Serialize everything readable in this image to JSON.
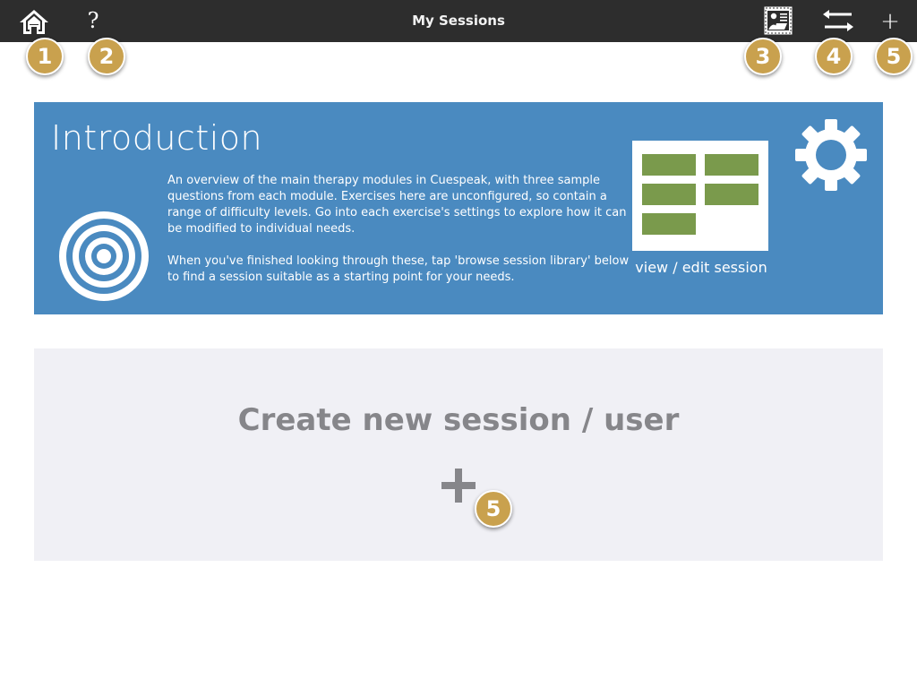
{
  "topbar": {
    "title": "My Sessions",
    "help_label": "?",
    "add_label": "+",
    "icons": {
      "home": "home-icon",
      "help": "question-icon",
      "media": "image-list-icon",
      "swap": "swap-arrows-icon",
      "add": "plus-icon"
    }
  },
  "badges": {
    "home": "1",
    "help": "2",
    "media": "3",
    "swap": "4",
    "add": "5",
    "create": "5"
  },
  "intro": {
    "title": "Introduction",
    "paragraph1": "An overview of the main therapy modules in Cuespeak, with three sample questions from each module. Exercises here are unconfigured, so contain a range of difficulty levels. Go into each exercise's settings to explore how it can be modified to individual needs.",
    "paragraph2": "When you've finished looking through these, tap 'browse session library' below to find a session suitable as a starting point for your needs.",
    "view_edit_label": "view / edit session",
    "icons": {
      "target": "target-icon",
      "preview": "session-preview-icon",
      "settings": "gear-icon"
    }
  },
  "create": {
    "label": "Create new session / user",
    "plus_icon": "plus-icon"
  },
  "colors": {
    "topbar": "#2d2d2d",
    "intro_background": "#4a8ac0",
    "create_background": "#f0f0f5",
    "badge": "#c9a14e",
    "preview_cell": "#7a9a4c",
    "create_text": "#86868a"
  }
}
